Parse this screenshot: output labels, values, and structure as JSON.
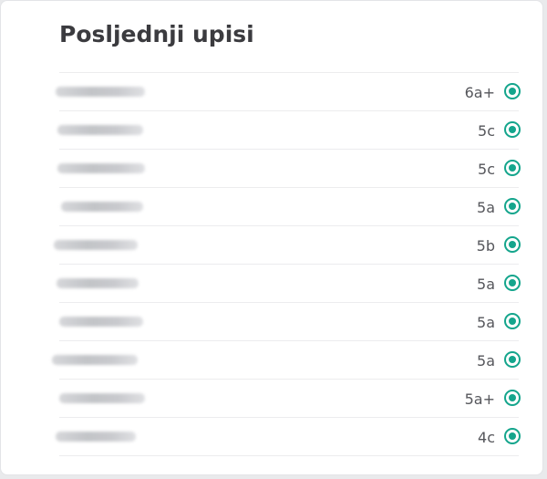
{
  "panel": {
    "title": "Posljednji upisi"
  },
  "enrollments": [
    {
      "name": "",
      "grade": "6a+",
      "status": "completed"
    },
    {
      "name": "",
      "grade": "5c",
      "status": "completed"
    },
    {
      "name": "",
      "grade": "5c",
      "status": "completed"
    },
    {
      "name": "",
      "grade": "5a",
      "status": "completed"
    },
    {
      "name": "",
      "grade": "5b",
      "status": "completed"
    },
    {
      "name": "",
      "grade": "5a",
      "status": "completed"
    },
    {
      "name": "",
      "grade": "5a",
      "status": "completed"
    },
    {
      "name": "",
      "grade": "5a",
      "status": "completed"
    },
    {
      "name": "",
      "grade": "5a+",
      "status": "completed"
    },
    {
      "name": "",
      "grade": "4c",
      "status": "completed"
    }
  ],
  "colors": {
    "accent": "#14a58c",
    "title": "#3b3b3f",
    "divider": "#ececee"
  },
  "icons": {
    "status": "radio-checked-icon"
  }
}
